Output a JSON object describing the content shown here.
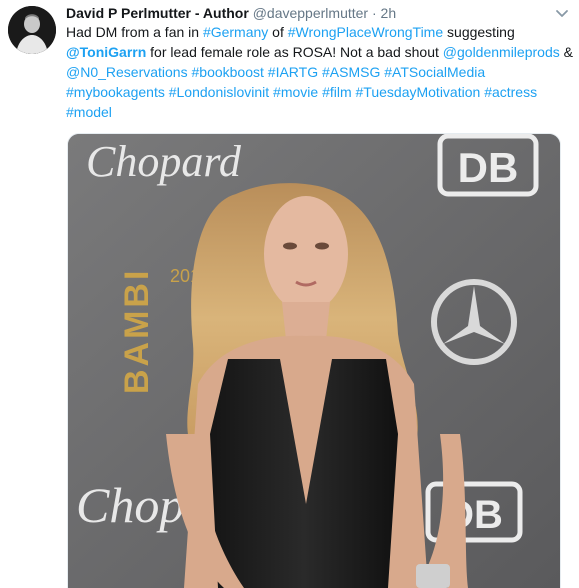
{
  "tweet": {
    "author_name": "David P Perlmutter - Author",
    "author_handle": "@davepperlmutter",
    "separator": "·",
    "time": "2h",
    "text_parts": [
      {
        "t": "Had DM from a fan in ",
        "kind": "text"
      },
      {
        "t": "#Germany",
        "kind": "link"
      },
      {
        "t": " of ",
        "kind": "text"
      },
      {
        "t": "#WrongPlaceWrongTime",
        "kind": "link"
      },
      {
        "t": " suggesting ",
        "kind": "text"
      },
      {
        "t": "@ToniGarrn",
        "kind": "mention"
      },
      {
        "t": " for lead female role as ROSA! Not a bad shout ",
        "kind": "text"
      },
      {
        "t": "@goldenmileprods",
        "kind": "link"
      },
      {
        "t": " & ",
        "kind": "text"
      },
      {
        "t": "@N0_Reservations",
        "kind": "link"
      },
      {
        "t": " ",
        "kind": "text"
      },
      {
        "t": "#bookboost",
        "kind": "link"
      },
      {
        "t": " ",
        "kind": "text"
      },
      {
        "t": "#IARTG",
        "kind": "link"
      },
      {
        "t": " ",
        "kind": "text"
      },
      {
        "t": "#ASMSG",
        "kind": "link"
      },
      {
        "t": " ",
        "kind": "text"
      },
      {
        "t": "#ATSocialMedia",
        "kind": "link"
      },
      {
        "t": " ",
        "kind": "text"
      },
      {
        "t": "#mybookagents",
        "kind": "link"
      },
      {
        "t": " ",
        "kind": "text"
      },
      {
        "t": "#Londonislovinit",
        "kind": "link"
      },
      {
        "t": " ",
        "kind": "text"
      },
      {
        "t": "#movie",
        "kind": "link"
      },
      {
        "t": " ",
        "kind": "text"
      },
      {
        "t": "#film",
        "kind": "link"
      },
      {
        "t": " ",
        "kind": "text"
      },
      {
        "t": "#TuesdayMotivation",
        "kind": "link"
      },
      {
        "t": " ",
        "kind": "text"
      },
      {
        "t": "#actress",
        "kind": "link"
      },
      {
        "t": " ",
        "kind": "text"
      },
      {
        "t": "#model",
        "kind": "link"
      }
    ],
    "icons": {
      "more": "chevron-down-icon",
      "avatar": "avatar"
    },
    "colors": {
      "link": "#1da1f2",
      "text": "#14171a",
      "muted": "#657786"
    }
  },
  "media": {
    "backdrop_words": {
      "brand_top": "Chopard",
      "brand_bottom": "Chop",
      "sponsor_top": "DB",
      "sponsor_bottom": "DB",
      "event": "BAMBI",
      "year": "2018"
    }
  }
}
